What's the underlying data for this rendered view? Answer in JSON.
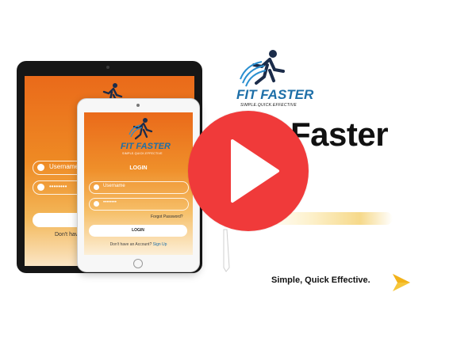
{
  "brand": {
    "logo_text": "FIT FASTER",
    "logo_tagline": "SIMPLE.QUICK.EFFECTIVE",
    "heading": "Faster",
    "tagline": "Simple, Quick Effective."
  },
  "app_screen": {
    "title": "LOGIN",
    "username_placeholder": "Username",
    "password_value": "••••••••",
    "forgot_link": "Forgot Password?",
    "login_button": "LOGIN",
    "signup_prompt": "Don't have an Account?",
    "signup_link": "Sign Up",
    "signup_prompt_truncated": "Don't have"
  },
  "video": {
    "play_icon": "play-icon"
  },
  "colors": {
    "accent_orange": "#ea6a1a",
    "brand_blue": "#1e6fa8",
    "play_red": "#f03a3a",
    "gold": "#f6c63a"
  }
}
